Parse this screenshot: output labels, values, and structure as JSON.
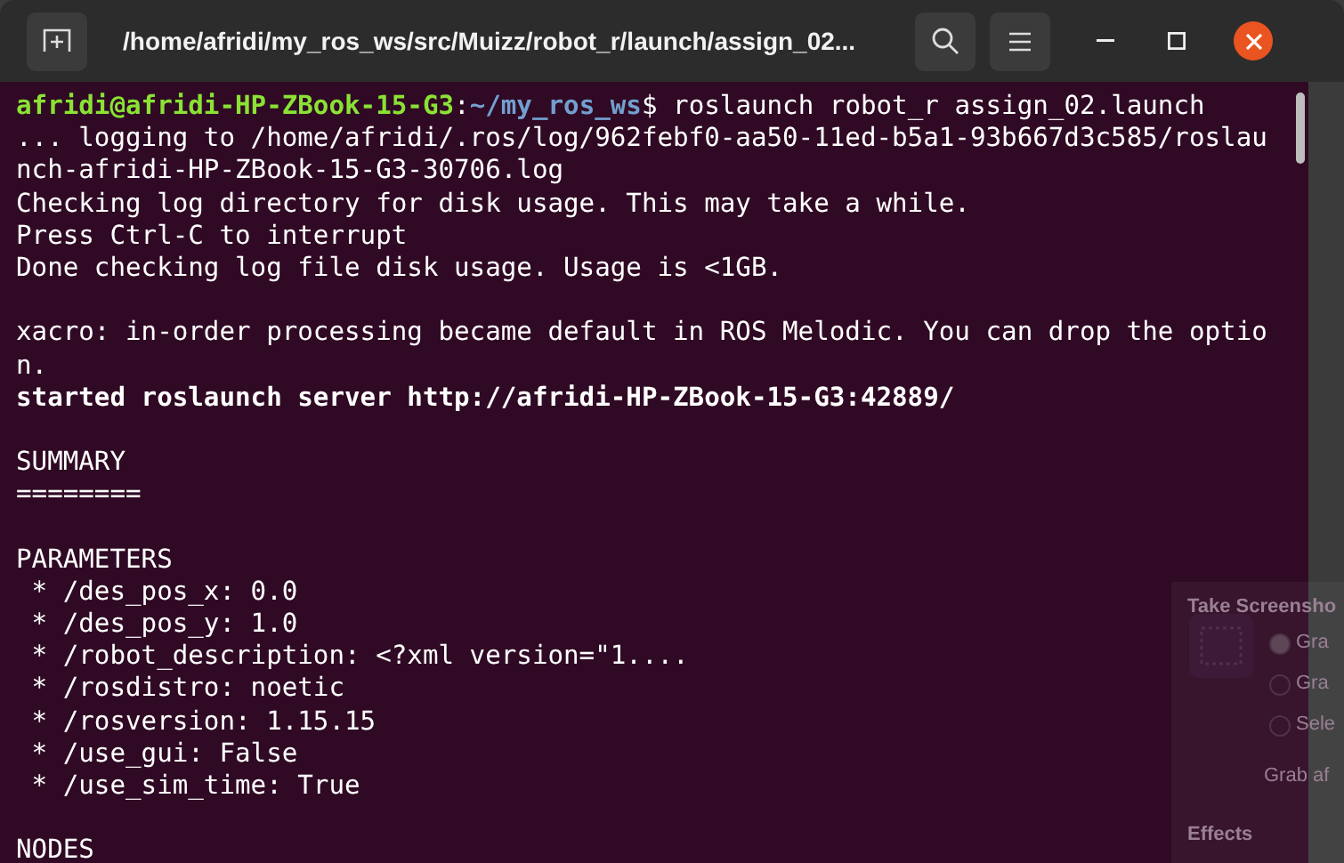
{
  "window": {
    "title": "/home/afridi/my_ros_ws/src/Muizz/robot_r/launch/assign_02..."
  },
  "prompt": {
    "user_host": "afridi@afridi-HP-ZBook-15-G3",
    "separator": ":",
    "path": "~/my_ros_ws",
    "symbol": "$",
    "command": " roslaunch robot_r assign_02.launch"
  },
  "lines": [
    {
      "kind": "text",
      "text": "... logging to /home/afridi/.ros/log/962febf0-aa50-11ed-b5a1-93b667d3c585/roslau",
      "bold": false
    },
    {
      "kind": "text",
      "text": "nch-afridi-HP-ZBook-15-G3-30706.log",
      "bold": false
    },
    {
      "kind": "text",
      "text": "Checking log directory for disk usage. This may take a while.",
      "bold": false
    },
    {
      "kind": "text",
      "text": "Press Ctrl-C to interrupt",
      "bold": false
    },
    {
      "kind": "text",
      "text": "Done checking log file disk usage. Usage is <1GB.",
      "bold": false
    },
    {
      "kind": "blank"
    },
    {
      "kind": "text",
      "text": "xacro: in-order processing became default in ROS Melodic. You can drop the optio",
      "bold": false
    },
    {
      "kind": "text",
      "text": "n.",
      "bold": false
    },
    {
      "kind": "text",
      "text": "started roslaunch server http://afridi-HP-ZBook-15-G3:42889/",
      "bold": true
    },
    {
      "kind": "blank"
    },
    {
      "kind": "text",
      "text": "SUMMARY",
      "bold": false
    },
    {
      "kind": "text",
      "text": "========",
      "bold": false
    },
    {
      "kind": "blank"
    },
    {
      "kind": "text",
      "text": "PARAMETERS",
      "bold": false
    },
    {
      "kind": "text",
      "text": " * /des_pos_x: 0.0",
      "bold": false
    },
    {
      "kind": "text",
      "text": " * /des_pos_y: 1.0",
      "bold": false
    },
    {
      "kind": "text",
      "text": " * /robot_description: <?xml version=\"1....",
      "bold": false
    },
    {
      "kind": "text",
      "text": " * /rosdistro: noetic",
      "bold": false
    },
    {
      "kind": "text",
      "text": " * /rosversion: 1.15.15",
      "bold": false
    },
    {
      "kind": "text",
      "text": " * /use_gui: False",
      "bold": false
    },
    {
      "kind": "text",
      "text": " * /use_sim_time: True",
      "bold": false
    },
    {
      "kind": "blank"
    },
    {
      "kind": "text",
      "text": "NODES",
      "bold": false
    }
  ],
  "background_dialog": {
    "title": "Take Screensho",
    "options": [
      {
        "label": "Gra",
        "selected": true
      },
      {
        "label": "Gra",
        "selected": false
      },
      {
        "label": "Sele",
        "selected": false
      }
    ],
    "delay_label": "Grab af",
    "section": "Effects"
  }
}
